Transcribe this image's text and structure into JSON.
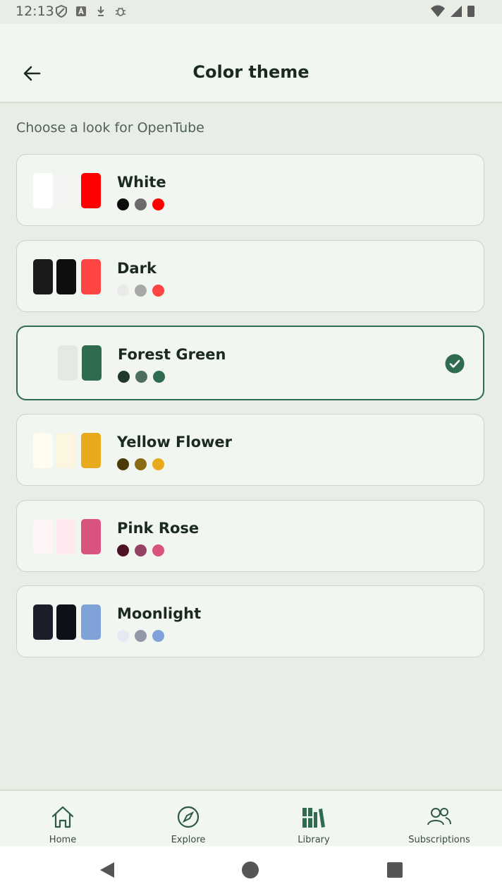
{
  "status_bar": {
    "time": "12:13"
  },
  "app_bar": {
    "title": "Color theme"
  },
  "subtitle": "Choose a look for OpenTube",
  "themes": [
    {
      "name": "White",
      "selected": false,
      "swatches": [
        "#ffffff",
        "#f4f5f3",
        "#ff0000"
      ],
      "dots": [
        "#0d0d0d",
        "#6b6b6b",
        "#ff0000"
      ]
    },
    {
      "name": "Dark",
      "selected": false,
      "swatches": [
        "#1a1a1a",
        "#0f0f0f",
        "#ff4444"
      ],
      "dots": [
        "#eaeaea",
        "#a8a8a8",
        "#ff4444"
      ]
    },
    {
      "name": "Forest Green",
      "selected": true,
      "swatches": [
        "#f2f6f0",
        "#e3eae2",
        "#2f6b4e"
      ],
      "dots": [
        "#1e3a2b",
        "#4d6f5e",
        "#2f6b4e"
      ]
    },
    {
      "name": "Yellow Flower",
      "selected": false,
      "swatches": [
        "#fffdf2",
        "#fcf5df",
        "#e8a91d"
      ],
      "dots": [
        "#4a3a0a",
        "#8a6a12",
        "#e8a91d"
      ]
    },
    {
      "name": "Pink Rose",
      "selected": false,
      "swatches": [
        "#fff5f7",
        "#fde9ee",
        "#d9537f"
      ],
      "dots": [
        "#4d1226",
        "#954262",
        "#d9537f"
      ]
    },
    {
      "name": "Moonlight",
      "selected": false,
      "swatches": [
        "#1a1f2a",
        "#0e1218",
        "#7fa3d9"
      ],
      "dots": [
        "#e6e9f2",
        "#9298a6",
        "#7fa3d9"
      ]
    }
  ],
  "bottom_nav": {
    "items": [
      {
        "label": "Home",
        "icon": "home-icon"
      },
      {
        "label": "Explore",
        "icon": "compass-icon"
      },
      {
        "label": "Library",
        "icon": "library-icon",
        "active": true
      },
      {
        "label": "Subscriptions",
        "icon": "people-icon"
      }
    ]
  },
  "colors": {
    "accent": "#2f6b4e",
    "background": "#e8ede6",
    "surface": "#f2f6f0"
  }
}
